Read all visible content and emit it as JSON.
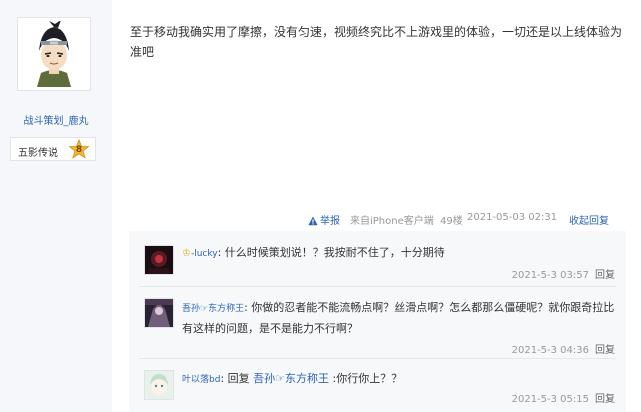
{
  "author": {
    "name": "战斗策划_鹿丸",
    "rank_name": "五影传说",
    "rank_level": "8"
  },
  "post": {
    "content": "至于移动我确实用了摩擦，没有匀速，视频终究比不上游戏里的体验，一切还是以上线体验为准吧",
    "report_label": "举报",
    "source": "来自iPhone客户端",
    "floor": "49楼",
    "timestamp": "2021-05-03 02:31",
    "collapse_label": "收起回复"
  },
  "replies": [
    {
      "user": "-lucky",
      "text": "什么时候策划说！？我按耐不住了，十分期待",
      "time": "2021-5-3 03:57",
      "reply_label": "回复"
    },
    {
      "user": "吾孙☞东方称王",
      "text": "你做的忍者能不能流畅点啊？丝滑点啊？怎么都那么僵硬呢？就你跟奇拉比有这样的问题，是不是能力不行啊？",
      "time": "2021-5-3 04:36",
      "reply_label": "回复"
    },
    {
      "user": "叶以落bd",
      "reply_word": "回复",
      "target_user": "吾孙☞东方称王",
      "text": ":你行你上？？",
      "time": "2021-5-3 05:15",
      "reply_label": "回复"
    }
  ],
  "icons": {
    "report": "warning-triangle-icon",
    "rank_badge": "star-badge-icon",
    "user_badge": "crown-icon"
  },
  "colors": {
    "link": "#2d64b3",
    "meta": "#999999",
    "left_bg": "#f5f7fa",
    "reply_bg": "#f7f8fa"
  }
}
